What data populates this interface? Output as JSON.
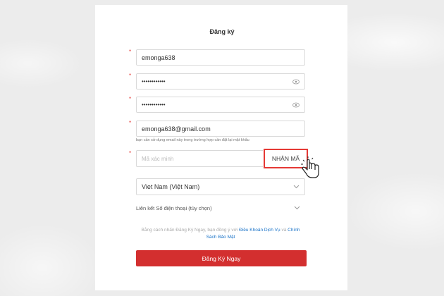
{
  "form": {
    "title": "Đăng ký",
    "username_value": "emonga638",
    "password_value": "••••••••••••",
    "confirm_password_value": "••••••••••••",
    "email_value": "emonga638@gmail.com",
    "email_hint": "bạn cần sử dụng email này trong trường hợp cần đặt lại mật khẩu",
    "code_placeholder": "Mã xác minh",
    "get_code_label": "NHẬN MÃ",
    "country_value": "Viet Nam (Việt Nam)",
    "phone_link_label": "Liên kết Số điện thoại (tùy chọn)",
    "terms_prefix": "Bằng cách nhấn Đăng Ký Ngay, bạn đồng ý với ",
    "terms_link1": "Điều Khoản Dịch Vụ",
    "terms_and": " và ",
    "terms_link2": "Chính Sách Bảo Mật",
    "submit_label": "Đăng Ký Ngay",
    "required_mark": "*"
  },
  "colors": {
    "accent": "#d32f2f",
    "link": "#1a73c8",
    "required": "#e53935"
  },
  "icons": [
    "eye-icon",
    "chevron-down-icon",
    "hand-cursor-icon"
  ]
}
